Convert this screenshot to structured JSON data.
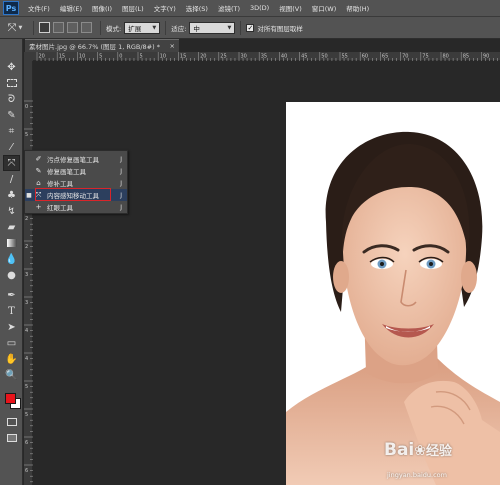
{
  "app": {
    "logo": "Ps",
    "menu": [
      "文件(F)",
      "编辑(E)",
      "图像(I)",
      "图层(L)",
      "文字(Y)",
      "选择(S)",
      "滤镜(T)",
      "3D(D)",
      "视图(V)",
      "窗口(W)",
      "帮助(H)"
    ]
  },
  "options_bar": {
    "tool_icon": "content-aware-move-icon",
    "mode_label": "模式:",
    "mode_value": "扩展",
    "adapt_label": "适应:",
    "adapt_value": "中",
    "sample_all_layers_label": "对所有图层取样",
    "sample_all_layers_checked": true
  },
  "document": {
    "tab_title": "素材图片.jpg @ 66.7% (图层 1, RGB/8#) *",
    "close_symbol": "×"
  },
  "ruler": {
    "top_labels": [
      "20",
      "15",
      "10",
      "5",
      "0",
      "5",
      "10",
      "15",
      "20",
      "25",
      "30",
      "35",
      "40",
      "45",
      "50",
      "55",
      "60",
      "65",
      "70",
      "75",
      "80",
      "85",
      "90"
    ],
    "left_labels": [
      "0",
      "5",
      "1",
      "1",
      "2",
      "2",
      "3",
      "3",
      "4",
      "4",
      "5",
      "5",
      "6",
      "6",
      "7"
    ]
  },
  "flyout": {
    "items": [
      {
        "label": "污点修复画笔工具",
        "key": "J",
        "icon": "spot-healing-brush-icon",
        "selected": false
      },
      {
        "label": "修复画笔工具",
        "key": "J",
        "icon": "healing-brush-icon",
        "selected": false
      },
      {
        "label": "修补工具",
        "key": "J",
        "icon": "patch-icon",
        "selected": false
      },
      {
        "label": "内容感知移动工具",
        "key": "J",
        "icon": "content-aware-move-icon",
        "selected": true
      },
      {
        "label": "红眼工具",
        "key": "J",
        "icon": "red-eye-icon",
        "selected": false
      }
    ]
  },
  "colors": {
    "foreground": "#e8141b",
    "background": "#ffffff",
    "highlight_border": "#d9252a"
  },
  "watermark": {
    "logo_text": "Bai",
    "logo_cn": "经验",
    "url": "jingyan.baidu.com"
  }
}
